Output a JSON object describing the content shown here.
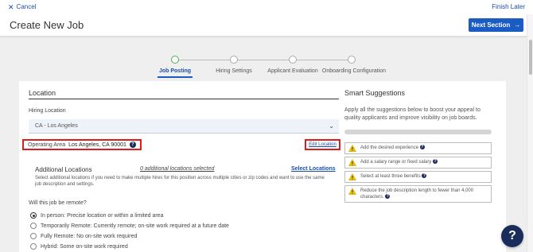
{
  "topbar": {
    "cancel_label": "Cancel",
    "finish_later_label": "Finish Later"
  },
  "header": {
    "title": "Create New Job",
    "next_label": "Next Section"
  },
  "stepper": {
    "steps": [
      {
        "label": "Job Posting",
        "active": true
      },
      {
        "label": "Hiring Settings",
        "active": false
      },
      {
        "label": "Applicant Evaluation",
        "active": false
      },
      {
        "label": "Onboarding Configuration",
        "active": false
      }
    ]
  },
  "location": {
    "section_title": "Location",
    "hiring_location_label": "Hiring Location",
    "hiring_location_value": "CA - Los Angeles",
    "operating_area_label": "Operating Area",
    "operating_area_value": "Los Angeles, CA 90001",
    "edit_location_label": "Edit Location",
    "additional_title": "Additional Locations",
    "additional_count": "0 additional locations selected",
    "select_locations_label": "Select Locations",
    "additional_desc": "Select additional locations if you need to make multiple hires for this position across multiple cities or zip codes and want to use the same job description and settings.",
    "remote_question": "Will this job be remote?",
    "remote_options": [
      {
        "label": "In person: Precise location or within a limited area",
        "selected": true
      },
      {
        "label": "Temporarily Remote: Currently remote; on-site work required at a future date",
        "selected": false
      },
      {
        "label": "Fully Remote: No on-site work required",
        "selected": false
      },
      {
        "label": "Hybrid: Some on-site work required",
        "selected": false
      }
    ]
  },
  "smart": {
    "title": "Smart Suggestions",
    "desc": "Apply all the suggestions below to boost your appeal to quality applicants and improve visibility on job boards.",
    "progress": 0,
    "suggestions": [
      "Add the desired experience",
      "Add a salary range or fixed salary",
      "Select at least three benefits",
      "Reduce the job description length to fewer than 4,000 characters."
    ]
  },
  "colors": {
    "accent": "#1a5bc4",
    "highlight": "#e01b1b",
    "step_active": "#4caf50",
    "help_fab": "#1a2d5a"
  },
  "help": {
    "label": "?"
  }
}
